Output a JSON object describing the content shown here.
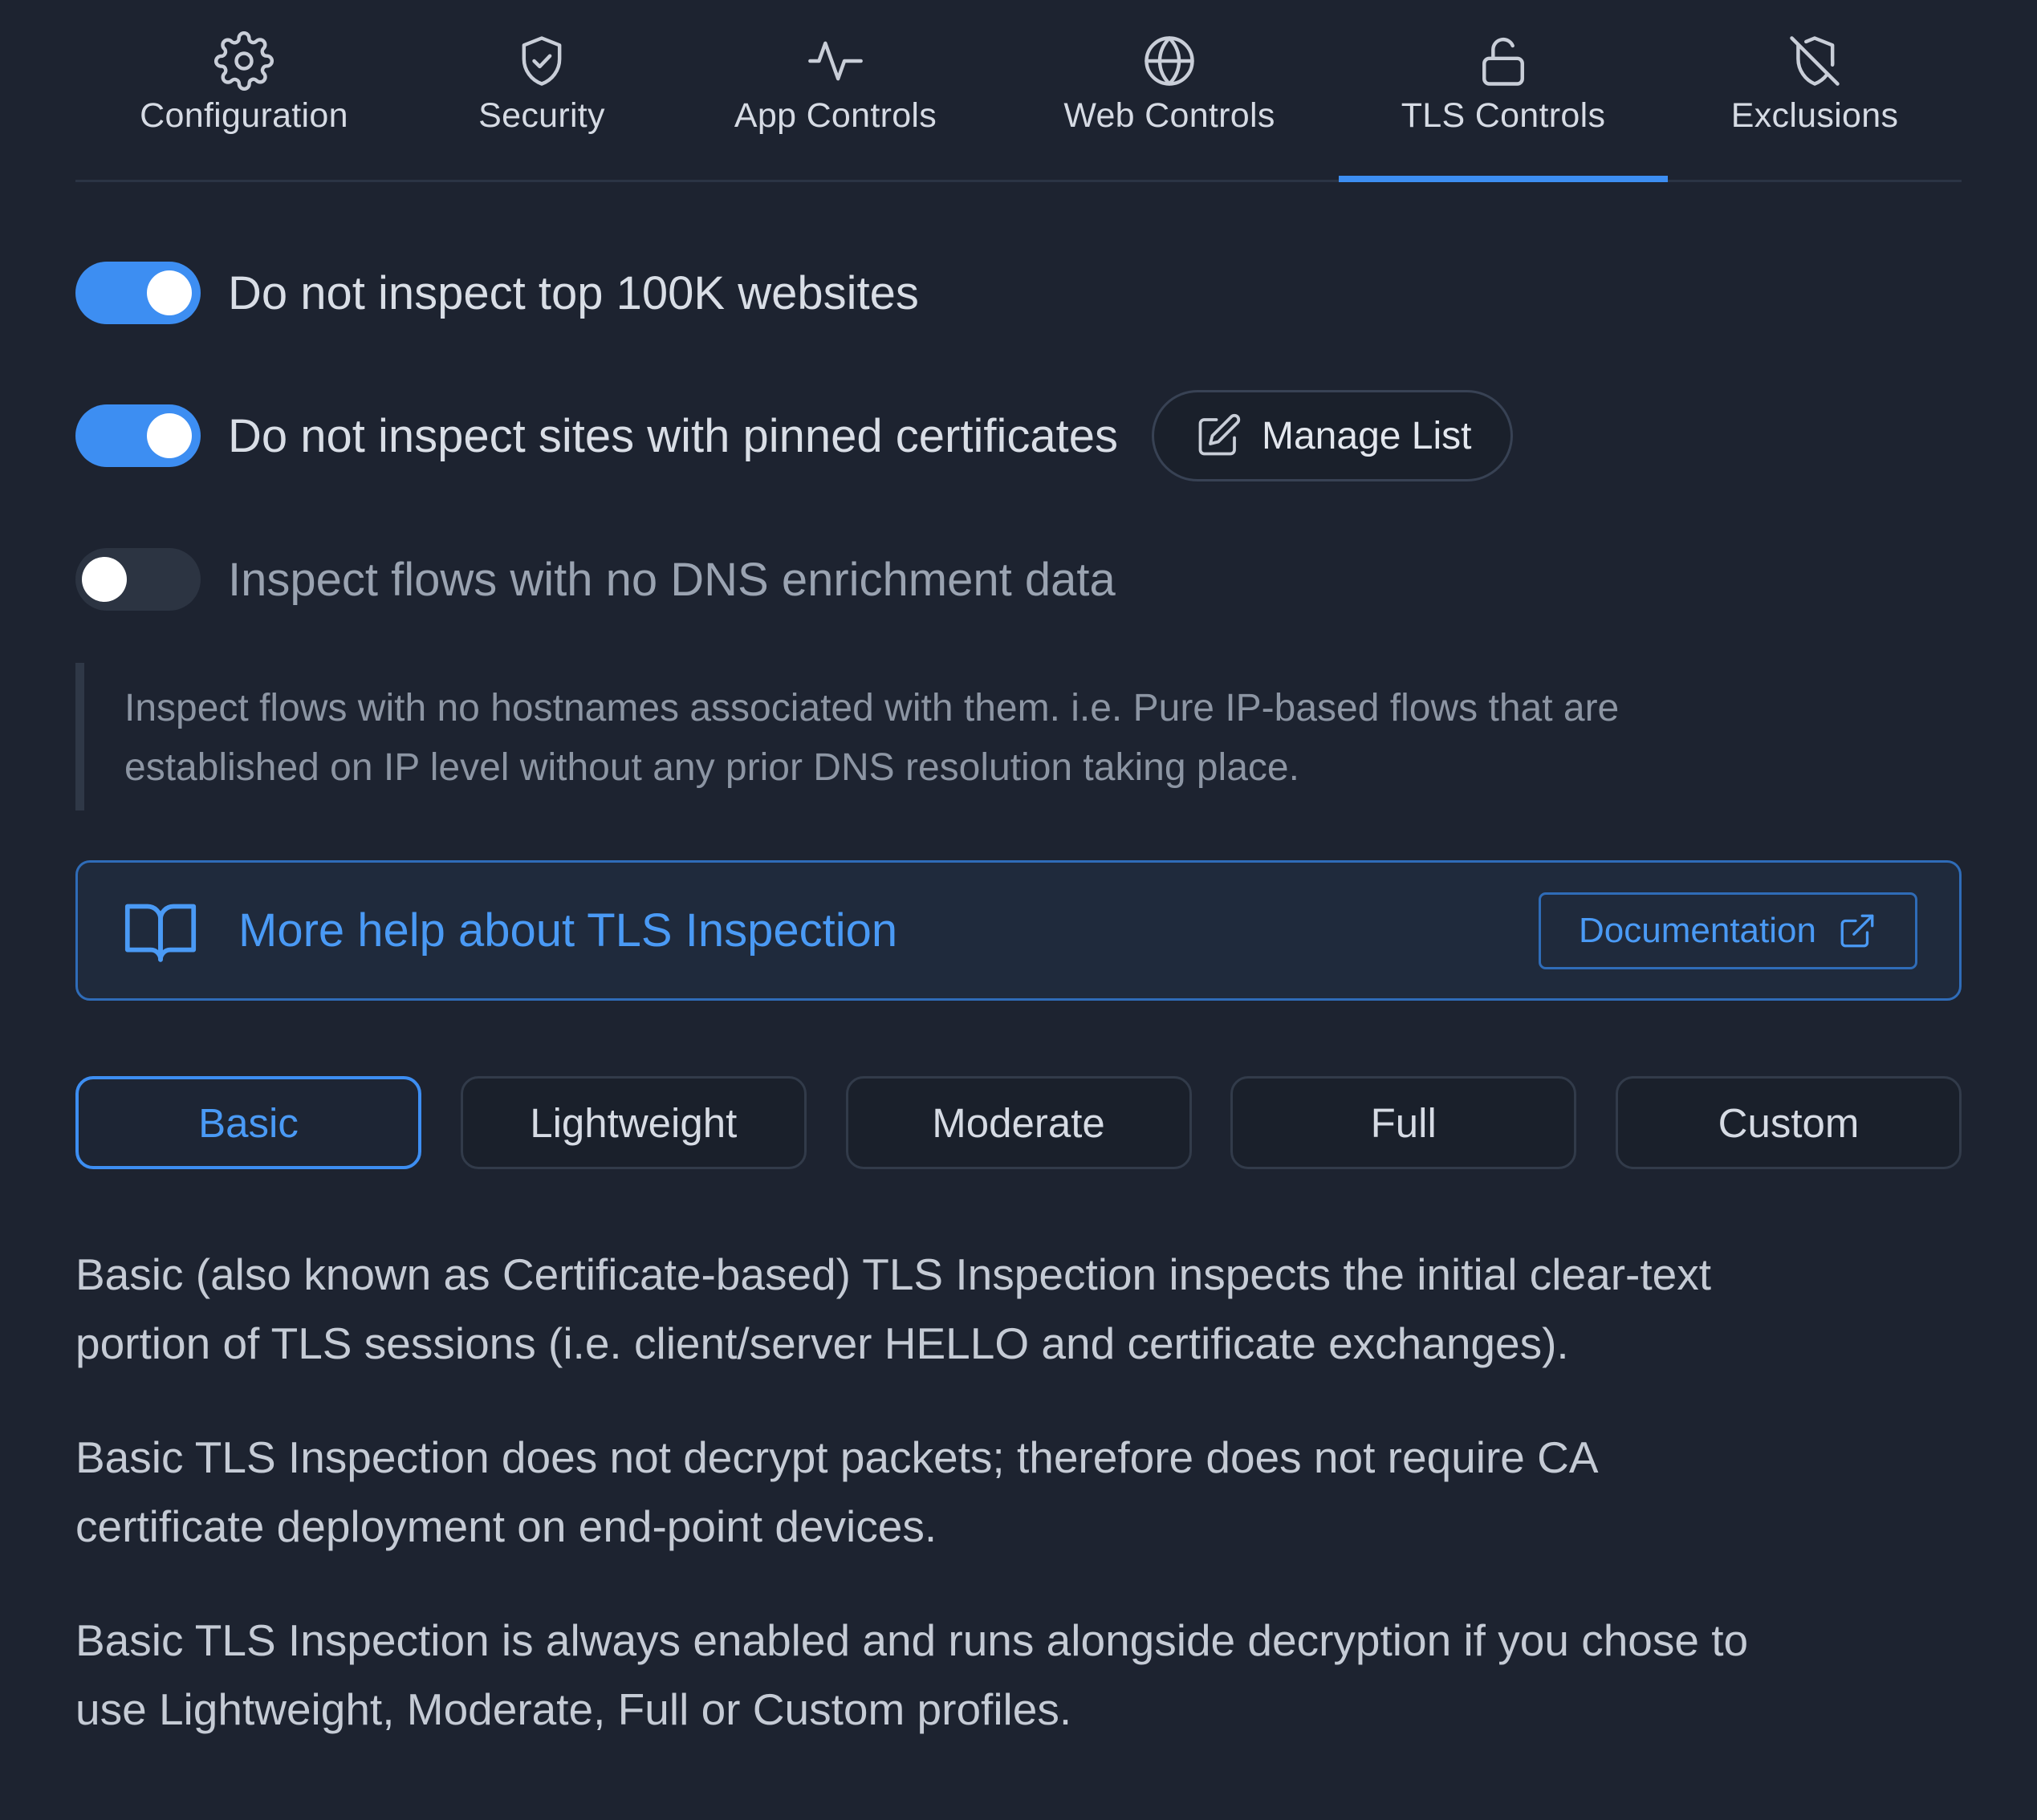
{
  "tabs": [
    {
      "label": "Configuration",
      "icon": "gear-icon"
    },
    {
      "label": "Security",
      "icon": "shield-check-icon"
    },
    {
      "label": "App Controls",
      "icon": "activity-icon"
    },
    {
      "label": "Web Controls",
      "icon": "globe-icon"
    },
    {
      "label": "TLS Controls",
      "icon": "unlock-icon",
      "active": true
    },
    {
      "label": "Exclusions",
      "icon": "shield-off-icon"
    }
  ],
  "toggles": {
    "top100k": {
      "label": "Do not inspect top 100K websites",
      "enabled": true
    },
    "pinned": {
      "label": "Do not inspect sites with pinned certificates",
      "enabled": true,
      "button_label": "Manage List"
    },
    "no_dns": {
      "label": "Inspect flows with no DNS enrichment data",
      "enabled": false
    }
  },
  "note": {
    "line1": "Inspect flows with no hostnames associated with them. i.e. Pure IP-based flows that are",
    "line2": "established on IP level without any prior DNS resolution taking place."
  },
  "help": {
    "title": "More help about TLS Inspection",
    "button_label": "Documentation"
  },
  "profiles": {
    "selected": "Basic",
    "options": [
      "Basic",
      "Lightweight",
      "Moderate",
      "Full",
      "Custom"
    ]
  },
  "description": {
    "p1_line1": "Basic (also known as Certificate-based) TLS Inspection inspects the initial clear-text",
    "p1_line2": "portion of TLS sessions (i.e. client/server HELLO and certificate exchanges).",
    "p2_line1": "Basic TLS Inspection does not decrypt packets; therefore does not require CA",
    "p2_line2": "certificate deployment on end-point devices.",
    "p3_line1": "Basic TLS Inspection is always enabled and runs alongside decryption if you chose to",
    "p3_line2": "use Lightweight, Moderate, Full or Custom profiles."
  },
  "colors": {
    "background": "#1d2330",
    "accent": "#3d8ef2",
    "link": "#4a9af5",
    "toggle_off": "#2c3442"
  }
}
